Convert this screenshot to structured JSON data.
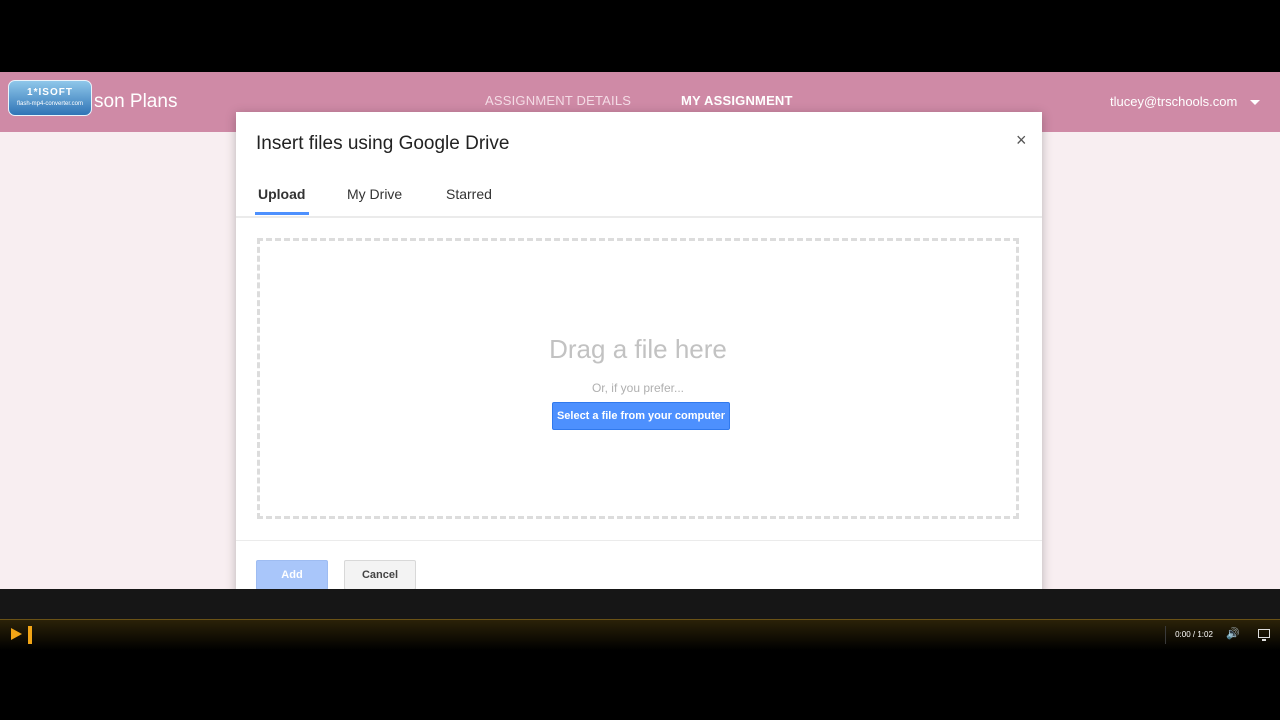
{
  "app": {
    "logo_text": "1*ISOFT",
    "logo_sub": "flash-mp4-converter.com",
    "title": "son Plans",
    "nav": {
      "details": "ASSIGNMENT DETAILS",
      "mine": "MY ASSIGNMENT"
    },
    "account": "tlucey@trschools.com"
  },
  "dialog": {
    "title": "Insert files using Google Drive",
    "close": "×",
    "tabs": [
      {
        "label": "Upload"
      },
      {
        "label": "My Drive"
      },
      {
        "label": "Starred"
      }
    ],
    "drag_text": "Drag a file here",
    "prefer_text": "Or, if you prefer...",
    "select_button": "Select a file from your computer",
    "add_button": "Add",
    "cancel_button": "Cancel"
  },
  "player": {
    "time": "0:00 / 1:02",
    "volume_glyph": "🔊",
    "progress": 0
  },
  "colors": {
    "header": "#cf8aa6",
    "accent": "#4d90fe",
    "player_accent": "#f2a516"
  }
}
